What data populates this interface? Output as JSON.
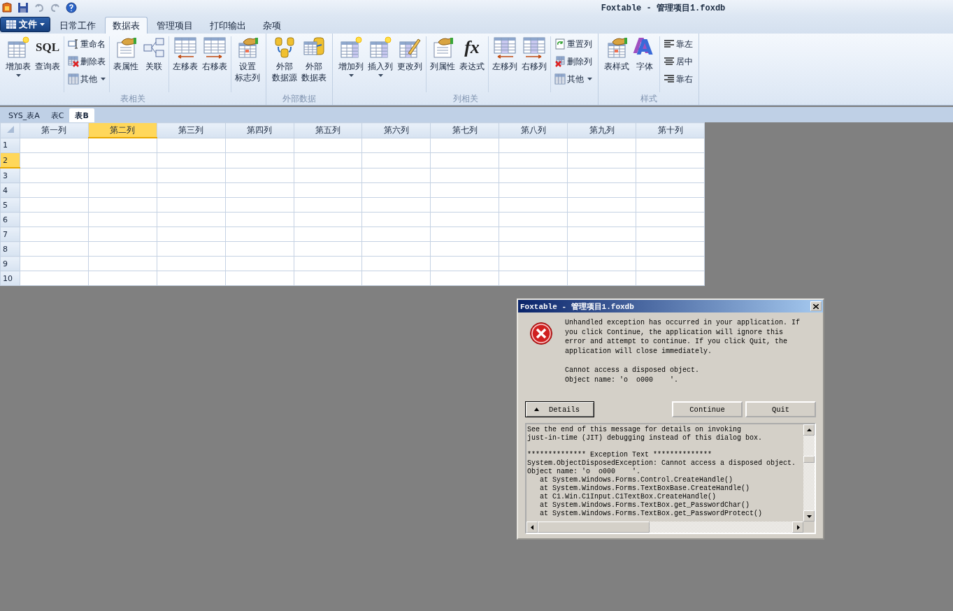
{
  "window": {
    "title": "Foxtable - 管理项目1.foxdb"
  },
  "file_menu": {
    "label": "文件"
  },
  "menu_tabs": [
    {
      "label": "日常工作",
      "selected": false
    },
    {
      "label": "数据表",
      "selected": true
    },
    {
      "label": "管理项目",
      "selected": false
    },
    {
      "label": "打印输出",
      "selected": false
    },
    {
      "label": "杂项",
      "selected": false
    }
  ],
  "ribbon": {
    "groups": [
      {
        "label": "表相关",
        "clusters": [
          {
            "kind": "large",
            "items": [
              {
                "label_lines": [
                  "增加表"
                ],
                "dropdown": true
              },
              {
                "label_lines": [
                  "查询表"
                ],
                "icon_text": "SQL",
                "dropdown": false
              }
            ]
          },
          {
            "kind": "stack",
            "items": [
              {
                "label": "重命名",
                "dropdown": false
              },
              {
                "label": "删除表",
                "dropdown": false
              },
              {
                "label": "其他",
                "dropdown": true
              }
            ]
          },
          {
            "kind": "large",
            "items": [
              {
                "label_lines": [
                  "表属性"
                ],
                "dropdown": false
              },
              {
                "label_lines": [
                  "关联"
                ],
                "dropdown": false
              }
            ]
          },
          {
            "kind": "large",
            "items": [
              {
                "label_lines": [
                  "左移表"
                ],
                "dropdown": false
              },
              {
                "label_lines": [
                  "右移表"
                ],
                "dropdown": false
              }
            ]
          },
          {
            "kind": "large",
            "items": [
              {
                "label_lines": [
                  "设置",
                  "标志列"
                ],
                "dropdown": false
              }
            ]
          }
        ]
      },
      {
        "label": "外部数据",
        "clusters": [
          {
            "kind": "large",
            "items": [
              {
                "label_lines": [
                  "外部",
                  "数据源"
                ],
                "dropdown": false
              },
              {
                "label_lines": [
                  "外部",
                  "数据表"
                ],
                "dropdown": false
              }
            ]
          }
        ]
      },
      {
        "label": "列相关",
        "clusters": [
          {
            "kind": "large",
            "items": [
              {
                "label_lines": [
                  "增加列"
                ],
                "dropdown": true
              },
              {
                "label_lines": [
                  "插入列"
                ],
                "dropdown": true
              },
              {
                "label_lines": [
                  "更改列"
                ],
                "dropdown": false
              }
            ]
          },
          {
            "kind": "large",
            "items": [
              {
                "label_lines": [
                  "列属性"
                ],
                "dropdown": false
              },
              {
                "label_lines": [
                  "表达式"
                ],
                "icon_text": "fx",
                "dropdown": false
              }
            ]
          },
          {
            "kind": "large",
            "items": [
              {
                "label_lines": [
                  "左移列"
                ],
                "dropdown": false
              },
              {
                "label_lines": [
                  "右移列"
                ],
                "dropdown": false
              }
            ]
          },
          {
            "kind": "stack",
            "items": [
              {
                "label": "重置列",
                "dropdown": false
              },
              {
                "label": "删除列",
                "dropdown": false
              },
              {
                "label": "其他",
                "dropdown": true
              }
            ]
          }
        ]
      },
      {
        "label": "样式",
        "clusters": [
          {
            "kind": "large",
            "items": [
              {
                "label_lines": [
                  "表样式"
                ],
                "dropdown": false
              },
              {
                "label_lines": [
                  "字体"
                ],
                "icon_text": "A",
                "dropdown": false
              }
            ]
          },
          {
            "kind": "stack",
            "items": [
              {
                "label": "靠左",
                "dropdown": false
              },
              {
                "label": "居中",
                "dropdown": false
              },
              {
                "label": "靠右",
                "dropdown": false
              }
            ]
          }
        ]
      }
    ]
  },
  "sheet_tabs": [
    {
      "label": "SYS_表A",
      "selected": false
    },
    {
      "label": "表C",
      "selected": false
    },
    {
      "label": "表B",
      "selected": true
    }
  ],
  "grid": {
    "columns": [
      {
        "label": "第一列",
        "selected": false
      },
      {
        "label": "第二列",
        "selected": true
      },
      {
        "label": "第三列",
        "selected": false
      },
      {
        "label": "第四列",
        "selected": false
      },
      {
        "label": "第五列",
        "selected": false
      },
      {
        "label": "第六列",
        "selected": false
      },
      {
        "label": "第七列",
        "selected": false
      },
      {
        "label": "第八列",
        "selected": false
      },
      {
        "label": "第九列",
        "selected": false
      },
      {
        "label": "第十列",
        "selected": false
      }
    ],
    "rows": [
      {
        "label": "1",
        "selected": false
      },
      {
        "label": "2",
        "selected": true
      },
      {
        "label": "3",
        "selected": false
      },
      {
        "label": "4",
        "selected": false
      },
      {
        "label": "5",
        "selected": false
      },
      {
        "label": "6",
        "selected": false
      },
      {
        "label": "7",
        "selected": false
      },
      {
        "label": "8",
        "selected": false
      },
      {
        "label": "9",
        "selected": false
      },
      {
        "label": "10",
        "selected": false
      }
    ]
  },
  "dialog": {
    "title": "Foxtable - 管理项目1.foxdb",
    "message": [
      "Unhandled exception has occurred in your application. If you click Continue, the application will ignore this error and attempt to continue. If you click Quit, the application will close immediately.",
      "Cannot access a disposed object.\nObject name: 'o  o000    '."
    ],
    "details_button": "Details",
    "buttons": [
      "Continue",
      "Quit"
    ],
    "details_paragraphs": [
      [
        "See the end of this message for details on invoking",
        "just-in-time (JIT) debugging instead of this dialog box."
      ],
      [
        "************** Exception Text **************",
        "System.ObjectDisposedException: Cannot access a disposed object.",
        "Object name: 'o  o000    '.",
        "   at System.Windows.Forms.Control.CreateHandle()",
        "   at System.Windows.Forms.TextBoxBase.CreateHandle()",
        "   at C1.Win.C1Input.C1TextBox.CreateHandle()",
        "   at System.Windows.Forms.TextBox.get_PasswordChar()",
        "   at System.Windows.Forms.TextBox.get_PasswordProtect()"
      ]
    ]
  }
}
